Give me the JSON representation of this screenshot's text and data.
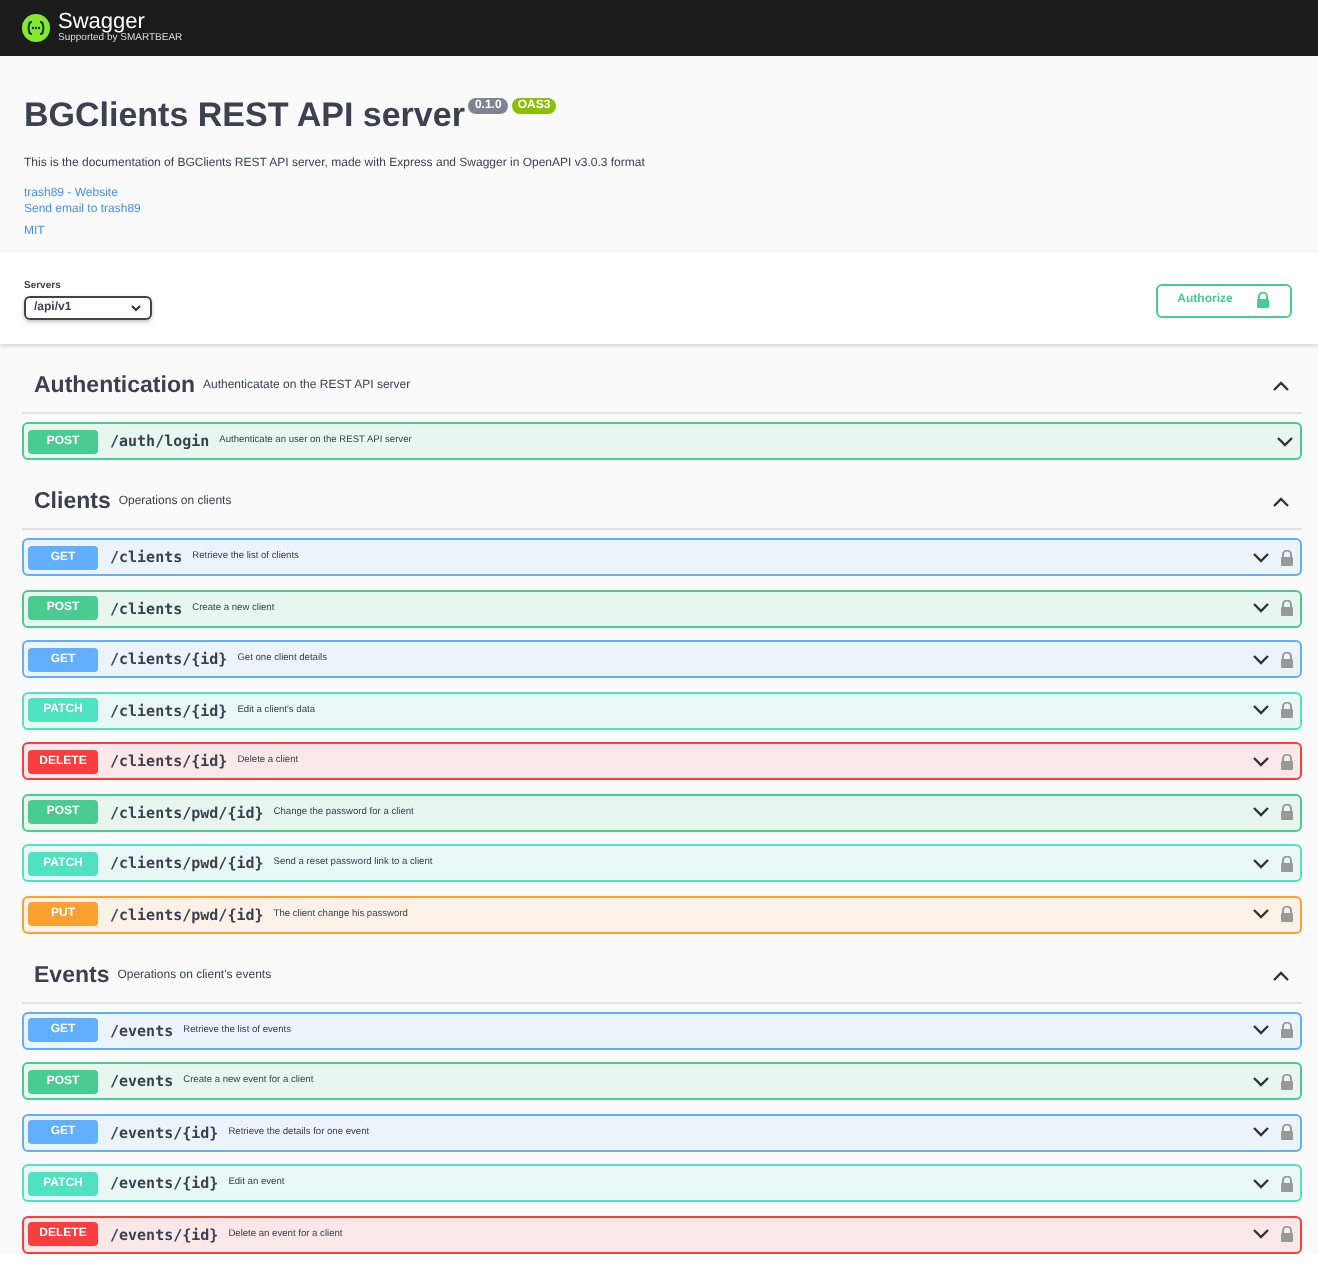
{
  "topbar": {
    "brand": "Swagger",
    "tagline": "Supported by SMARTBEAR"
  },
  "info": {
    "title": "BGClients REST API server",
    "version": "0.1.0",
    "oas": "OAS3",
    "description": "This is the documentation of BGClients REST API server, made with Express and Swagger in OpenAPI v3.0.3 format",
    "links": [
      "trash89 - Website",
      "Send email to trash89"
    ],
    "license": "MIT"
  },
  "servers": {
    "label": "Servers",
    "value": "/api/v1"
  },
  "authorize": {
    "label": "Authorize"
  },
  "tags": [
    {
      "name": "Authentication",
      "description": "Authenticatate on the REST API server",
      "expanded": true,
      "operations": [
        {
          "method": "POST",
          "kind": "post",
          "path": "/auth/login",
          "summary": "Authenticate an user on the REST API server",
          "locked": false
        }
      ]
    },
    {
      "name": "Clients",
      "description": "Operations on clients",
      "expanded": true,
      "operations": [
        {
          "method": "GET",
          "kind": "get",
          "path": "/clients",
          "summary": "Retrieve the list of clients",
          "locked": true
        },
        {
          "method": "POST",
          "kind": "post",
          "path": "/clients",
          "summary": "Create a new client",
          "locked": true
        },
        {
          "method": "GET",
          "kind": "get",
          "path": "/clients/{id}",
          "summary": "Get one client details",
          "locked": true
        },
        {
          "method": "PATCH",
          "kind": "patch",
          "path": "/clients/{id}",
          "summary": "Edit a client's data",
          "locked": true
        },
        {
          "method": "DELETE",
          "kind": "delete",
          "path": "/clients/{id}",
          "summary": "Delete a client",
          "locked": true
        },
        {
          "method": "POST",
          "kind": "post",
          "path": "/clients/pwd/{id}",
          "summary": "Change the password for a client",
          "locked": true
        },
        {
          "method": "PATCH",
          "kind": "patch",
          "path": "/clients/pwd/{id}",
          "summary": "Send a reset password link to a client",
          "locked": true
        },
        {
          "method": "PUT",
          "kind": "put",
          "path": "/clients/pwd/{id}",
          "summary": "The client change his password",
          "locked": true
        }
      ]
    },
    {
      "name": "Events",
      "description": "Operations on client's events",
      "expanded": true,
      "operations": [
        {
          "method": "GET",
          "kind": "get",
          "path": "/events",
          "summary": "Retrieve the list of events",
          "locked": true
        },
        {
          "method": "POST",
          "kind": "post",
          "path": "/events",
          "summary": "Create a new event for a client",
          "locked": true
        },
        {
          "method": "GET",
          "kind": "get",
          "path": "/events/{id}",
          "summary": "Retrieve the details for one event",
          "locked": true
        },
        {
          "method": "PATCH",
          "kind": "patch",
          "path": "/events/{id}",
          "summary": "Edit an event",
          "locked": true
        },
        {
          "method": "DELETE",
          "kind": "delete",
          "path": "/events/{id}",
          "summary": "Delete an event for a client",
          "locked": true
        }
      ]
    }
  ]
}
